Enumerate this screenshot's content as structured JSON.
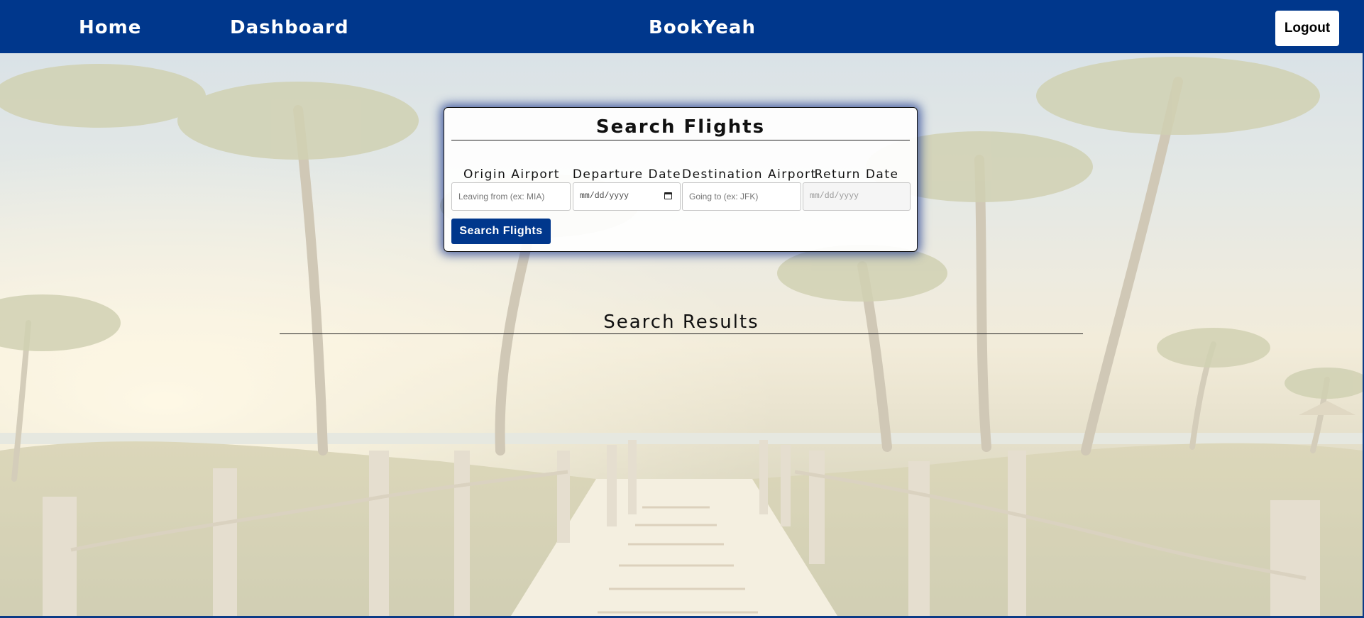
{
  "nav": {
    "home_label": "Home",
    "dashboard_label": "Dashboard",
    "brand": "BookYeah",
    "logout_label": "Logout"
  },
  "search": {
    "title": "Search Flights",
    "fields": [
      {
        "label": "Origin Airport",
        "placeholder": "Leaving from (ex: MIA)",
        "value": ""
      },
      {
        "label": "Departure Date",
        "placeholder": "mm/dd/yyyy",
        "value": ""
      },
      {
        "label": "Destination Airport",
        "placeholder": "Going to (ex: JFK)",
        "value": ""
      },
      {
        "label": "Return Date",
        "placeholder": "mm/dd/yyyy",
        "value": ""
      }
    ],
    "submit_label": "Search Flights"
  },
  "results": {
    "title": "Search Results",
    "items": []
  },
  "colors": {
    "primary": "#00378C",
    "card_bg": "#FFFFFF",
    "text": "#111111"
  },
  "icons": {
    "departure_date_picker": "calendar-icon"
  }
}
